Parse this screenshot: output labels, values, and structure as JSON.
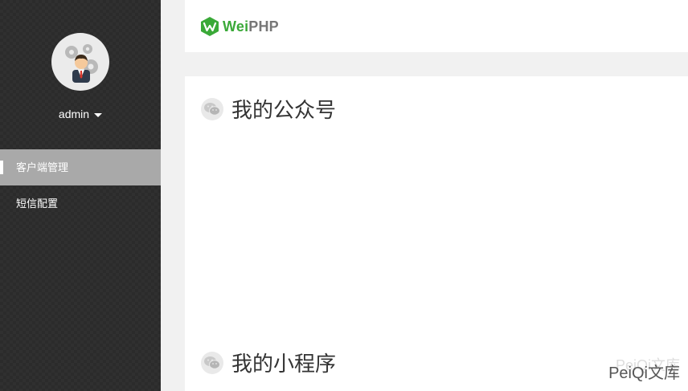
{
  "user": {
    "name": "admin"
  },
  "nav": {
    "items": [
      {
        "label": "客户端管理",
        "active": true
      },
      {
        "label": "短信配置",
        "active": false
      }
    ]
  },
  "header": {
    "logo_part1": "Wei",
    "logo_part2": "PHP"
  },
  "main": {
    "sections": [
      {
        "title": "我的公众号"
      },
      {
        "title": "我的小程序"
      }
    ]
  },
  "watermark": {
    "text": "PeiQi文库",
    "faint_text": "PeiQi文库"
  },
  "colors": {
    "sidebar": "#2b2b2b",
    "active_nav": "#a9a9a9",
    "brand_green": "#3aa938"
  }
}
